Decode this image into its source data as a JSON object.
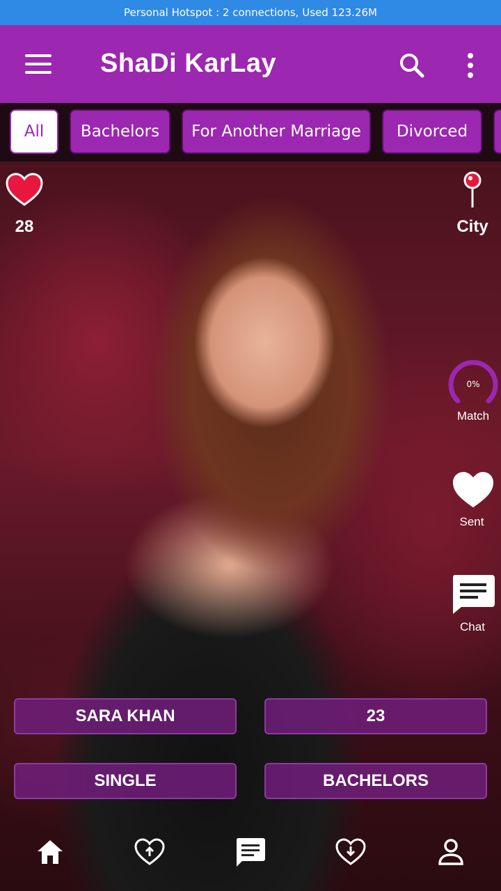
{
  "status_bar": {
    "text": "Personal Hotspot : 2 connections, Used 123.26M"
  },
  "app_bar": {
    "title": "ShaDi KarLay",
    "icons": [
      "menu-icon",
      "search-icon",
      "more-vert-icon"
    ]
  },
  "filters": {
    "items": [
      {
        "label": "All",
        "active": true
      },
      {
        "label": "Bachelors",
        "active": false
      },
      {
        "label": "For Another Marriage",
        "active": false
      },
      {
        "label": "Divorced",
        "active": false
      }
    ]
  },
  "profile": {
    "likes": "28",
    "location_label": "City",
    "match_label": "Match",
    "match_value": "0%",
    "sent_label": "Sent",
    "chat_label": "Chat",
    "name": "SARA KHAN",
    "age": "23",
    "status": "SINGLE",
    "category": "BACHELORS"
  },
  "bottom_nav": {
    "items": [
      "home-icon",
      "heart-upload-icon",
      "chat-icon",
      "heart-download-icon",
      "person-icon"
    ]
  },
  "colors": {
    "primary": "#9c27b0",
    "status_bar": "#2f8ae6",
    "like_heart": "#e8173f"
  }
}
